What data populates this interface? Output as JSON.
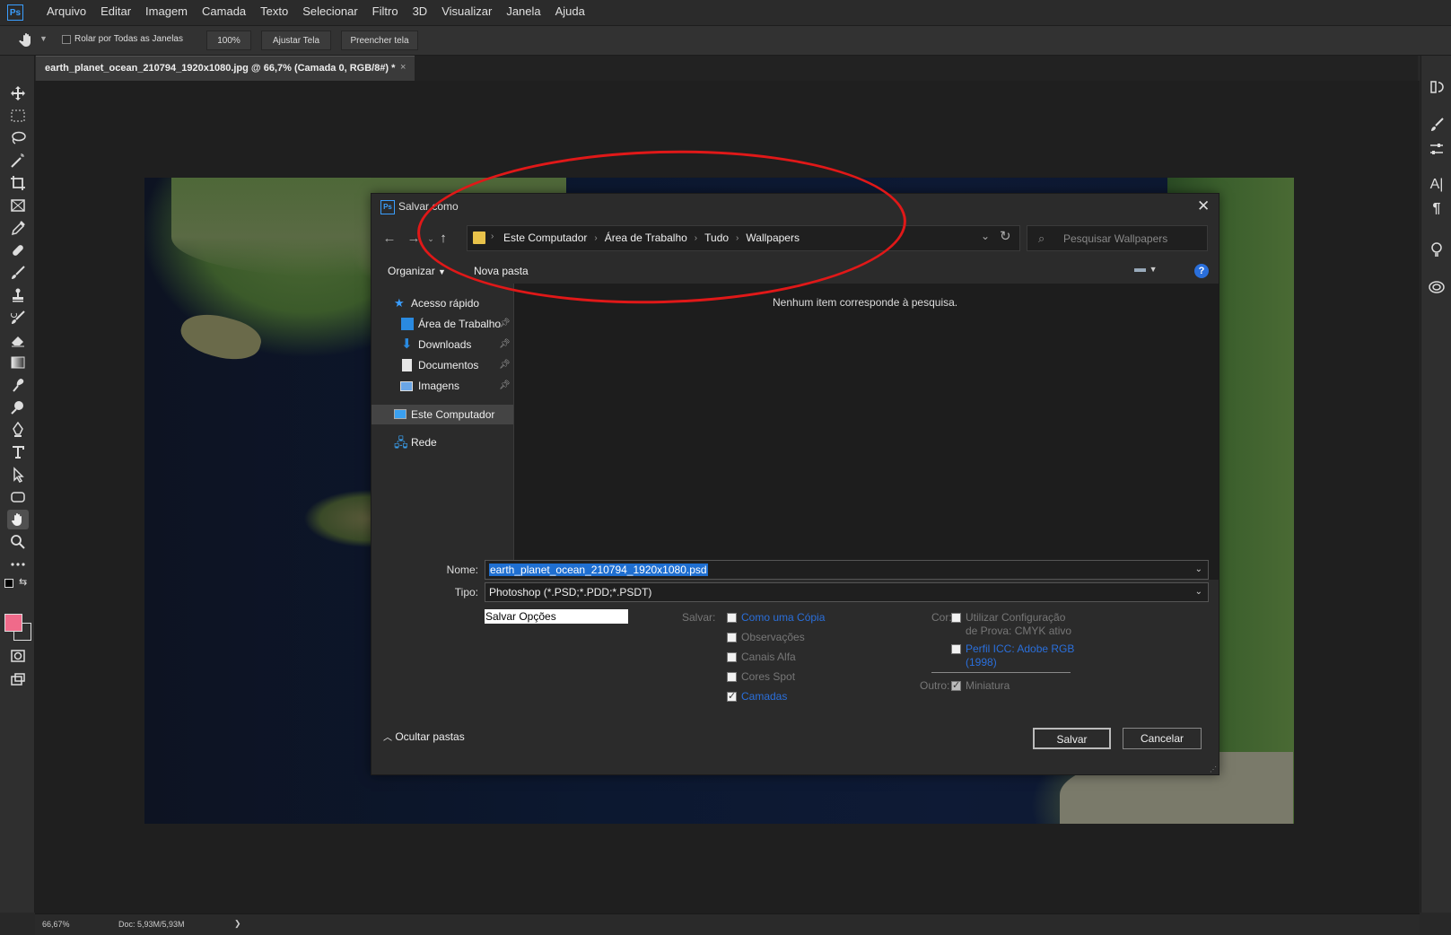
{
  "app": {
    "logo": "Ps",
    "menu": [
      "Arquivo",
      "Editar",
      "Imagem",
      "Camada",
      "Texto",
      "Selecionar",
      "Filtro",
      "3D",
      "Visualizar",
      "Janela",
      "Ajuda"
    ]
  },
  "options_bar": {
    "scroll_all_label": "Rolar por Todas as Janelas",
    "zoom_value": "100%",
    "fit_screen_label": "Ajustar Tela",
    "fill_screen_label": "Preencher tela"
  },
  "document_tab": {
    "title": "earth_planet_ocean_210794_1920x1080.jpg @ 66,7% (Camada 0, RGB/8#) *",
    "close": "×"
  },
  "status_bar": {
    "zoom": "66,67%",
    "doc_size": "Doc: 5,93M/5,93M",
    "arrow": "❯"
  },
  "dialog": {
    "logo": "Ps",
    "title": "Salvar como",
    "close": "✕",
    "breadcrumbs": [
      "Este Computador",
      "Área de Trabalho",
      "Tudo",
      "Wallpapers"
    ],
    "search_placeholder": "Pesquisar Wallpapers",
    "organize_label": "Organizar",
    "new_folder_label": "Nova pasta",
    "empty_message": "Nenhum item corresponde à pesquisa.",
    "nav": {
      "quick_access": "Acesso rápido",
      "desktop": "Área de Trabalho",
      "downloads": "Downloads",
      "documents": "Documentos",
      "images": "Imagens",
      "this_pc": "Este Computador",
      "network": "Rede"
    },
    "name_label": "Nome:",
    "name_value": "earth_planet_ocean_210794_1920x1080.psd",
    "type_label": "Tipo:",
    "type_value": "Photoshop (*.PSD;*.PDD;*.PSDT)",
    "save_options_label": "Salvar Opções",
    "save_label": "Salvar:",
    "save_opts": [
      {
        "label": "Como uma Cópia",
        "checked": false,
        "link": true
      },
      {
        "label": "Observações",
        "checked": false,
        "link": false
      },
      {
        "label": "Canais Alfa",
        "checked": false,
        "link": false
      },
      {
        "label": "Cores Spot",
        "checked": false,
        "link": false
      },
      {
        "label": "Camadas",
        "checked": true,
        "link": true
      }
    ],
    "color_label": "Cor:",
    "proof_label_1": "Utilizar Configuração",
    "proof_label_2": "de Prova: CMYK ativo",
    "icc_label_1": "Perfil ICC: Adobe RGB",
    "icc_label_2": "(1998)",
    "other_label": "Outro:",
    "thumbnail_label": "Miniatura",
    "hide_folders_label": "Ocultar pastas",
    "save_button": "Salvar",
    "cancel_button": "Cancelar"
  },
  "colors": {
    "foreground": "#f06a8a",
    "background": "#1a2a4a",
    "accent": "#2a6fdb",
    "annotation": "#e01818"
  }
}
